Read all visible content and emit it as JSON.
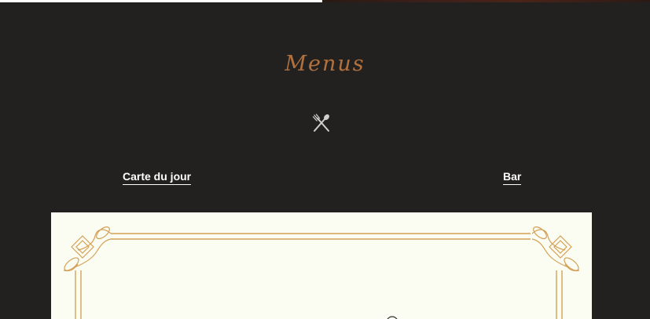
{
  "section": {
    "title": "Menus"
  },
  "tabs": [
    {
      "label": "Carte du jour"
    },
    {
      "label": "Bar"
    }
  ],
  "icons": {
    "section_icon": "fork-and-knife-icon",
    "frame_ornament": "ornamental-corner"
  },
  "colors": {
    "background": "#222120",
    "accent": "#b0713f",
    "tab_text": "#ffffff",
    "card_background": "#fbfdf3",
    "frame_gold": "#d4a056"
  }
}
